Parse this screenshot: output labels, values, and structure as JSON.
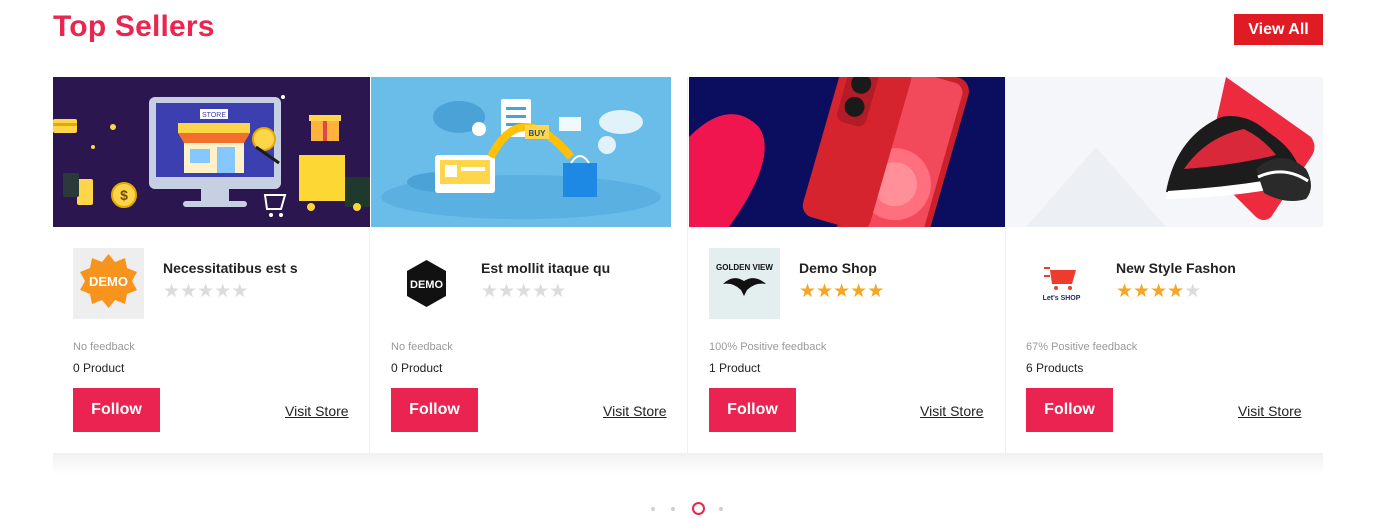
{
  "header": {
    "title": "Top Sellers",
    "view_all_label": "View All"
  },
  "sellers": [
    {
      "name": "Necessitatibus est s",
      "rating": 0,
      "rating_max": 5,
      "logo_text": "DEMO",
      "feedback": "No feedback",
      "products": "0 Product",
      "follow_label": "Follow",
      "visit_label": "Visit Store"
    },
    {
      "name": "Est mollit itaque qu",
      "rating": 0,
      "rating_max": 5,
      "logo_text": "DEMO",
      "feedback": "No feedback",
      "products": "0 Product",
      "follow_label": "Follow",
      "visit_label": "Visit Store"
    },
    {
      "name": "Demo Shop",
      "rating": 5,
      "rating_max": 5,
      "logo_text": "GOLDEN VIEW",
      "feedback": "100% Positive feedback",
      "products": "1 Product",
      "follow_label": "Follow",
      "visit_label": "Visit Store"
    },
    {
      "name": "New Style Fashon",
      "rating": 4,
      "rating_max": 5,
      "logo_text": "Let's SHOP",
      "feedback": "67% Positive feedback",
      "products": "6 Products",
      "follow_label": "Follow",
      "visit_label": "Visit Store"
    }
  ],
  "banner_texts": {
    "store_sign": "STORE",
    "buy_tag": "BUY"
  },
  "carousel": {
    "page_count": 4,
    "active_index": 2
  },
  "colors": {
    "accent": "#e8264f",
    "view_all_bg": "#e01b24",
    "star_on": "#f5a623",
    "star_off": "#dcdcdc"
  }
}
